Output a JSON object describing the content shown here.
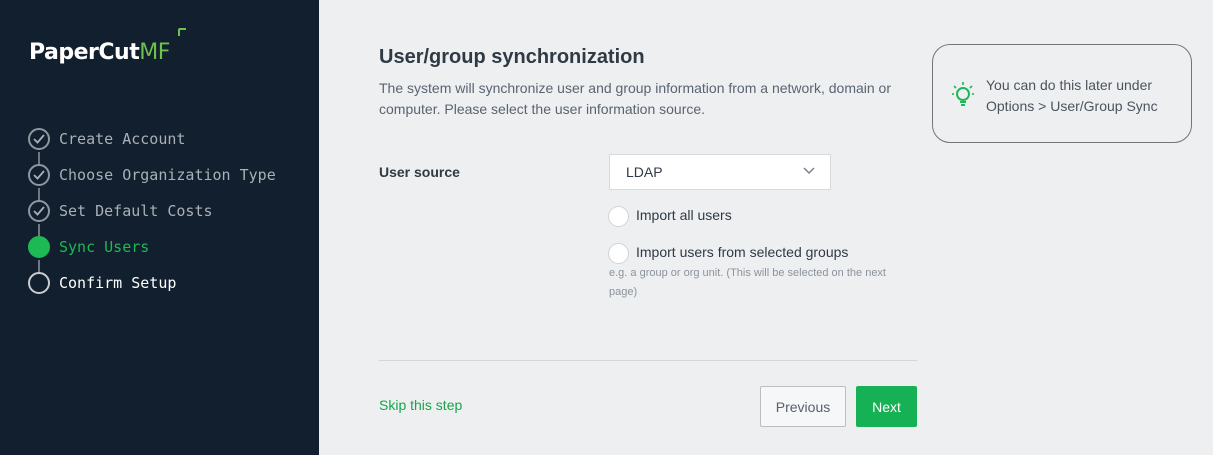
{
  "brand": {
    "name_main": "PaperCut",
    "name_suffix": "MF",
    "accent": "#6cc24a"
  },
  "steps": [
    {
      "label": "Create Account",
      "state": "done"
    },
    {
      "label": "Choose Organization Type",
      "state": "done"
    },
    {
      "label": "Set Default Costs",
      "state": "done"
    },
    {
      "label": "Sync Users",
      "state": "active"
    },
    {
      "label": "Confirm Setup",
      "state": "todo"
    }
  ],
  "main": {
    "title": "User/group synchronization",
    "description": "The system will synchronize user and group information from a network, domain or computer. Please select the user information source.",
    "user_source_label": "User source",
    "user_source_value": "LDAP",
    "radio_all_label": "Import all users",
    "radio_groups_label": "Import users from selected groups",
    "radio_groups_hint": "e.g. a group or org unit. (This will be selected on the next page)"
  },
  "footer": {
    "skip_label": "Skip this step",
    "previous_label": "Previous",
    "next_label": "Next"
  },
  "tip": {
    "icon": "lightbulb-icon",
    "text": "You can do this later under Options > User/Group Sync"
  },
  "colors": {
    "sidebar_bg": "#111f2e",
    "primary_green": "#16b154",
    "page_bg": "#eeeff1"
  }
}
